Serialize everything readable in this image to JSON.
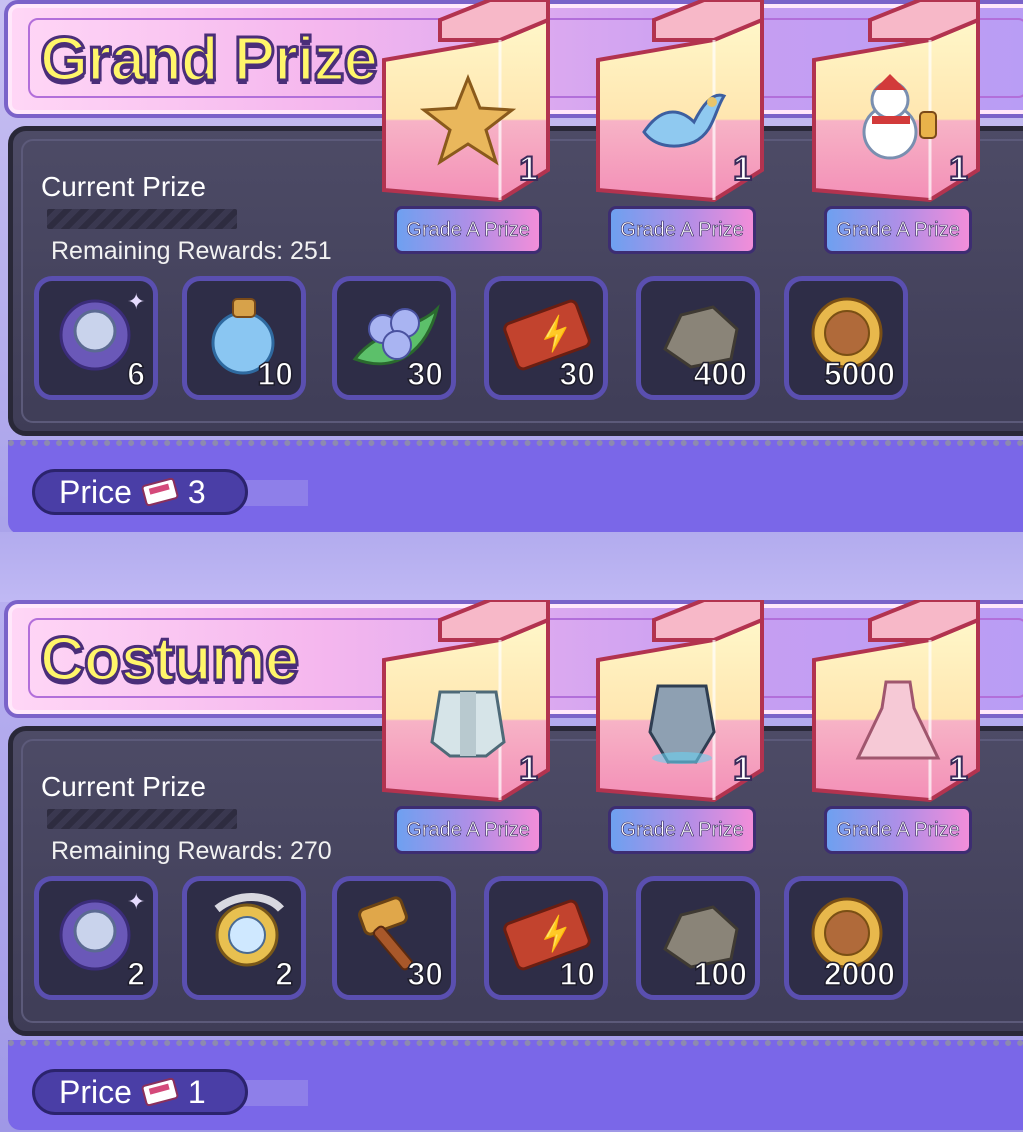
{
  "sections": [
    {
      "title": "Grand Prize",
      "current_prize_label": "Current Prize",
      "remaining_label": "Remaining Rewards: 251",
      "grade_prizes": [
        {
          "label": "Grade A Prize",
          "qty": "1",
          "item": "star-icon"
        },
        {
          "label": "Grade A Prize",
          "qty": "1",
          "item": "phoenix-icon"
        },
        {
          "label": "Grade A Prize",
          "qty": "1",
          "item": "snowman-icon"
        }
      ],
      "rewards": [
        {
          "item": "gear-crystal-icon",
          "count": "6"
        },
        {
          "item": "potion-icon",
          "count": "10"
        },
        {
          "item": "berries-icon",
          "count": "30"
        },
        {
          "item": "ticket-icon",
          "count": "30"
        },
        {
          "item": "ore-icon",
          "count": "400"
        },
        {
          "item": "coin-icon",
          "count": "5000"
        }
      ],
      "price_label": "Price",
      "price_value": "3"
    },
    {
      "title": "Costume",
      "current_prize_label": "Current Prize",
      "remaining_label": "Remaining Rewards: 270",
      "grade_prizes": [
        {
          "label": "Grade A Prize",
          "qty": "1",
          "item": "white-armor-icon"
        },
        {
          "label": "Grade A Prize",
          "qty": "1",
          "item": "knight-armor-icon"
        },
        {
          "label": "Grade A Prize",
          "qty": "1",
          "item": "pink-dress-icon"
        }
      ],
      "rewards": [
        {
          "item": "gear-crystal-icon",
          "count": "2"
        },
        {
          "item": "lens-ring-icon",
          "count": "2"
        },
        {
          "item": "hammer-icon",
          "count": "30"
        },
        {
          "item": "ticket-icon",
          "count": "10"
        },
        {
          "item": "ore-icon",
          "count": "100"
        },
        {
          "item": "coin-icon",
          "count": "2000"
        }
      ],
      "price_label": "Price",
      "price_value": "1"
    }
  ]
}
